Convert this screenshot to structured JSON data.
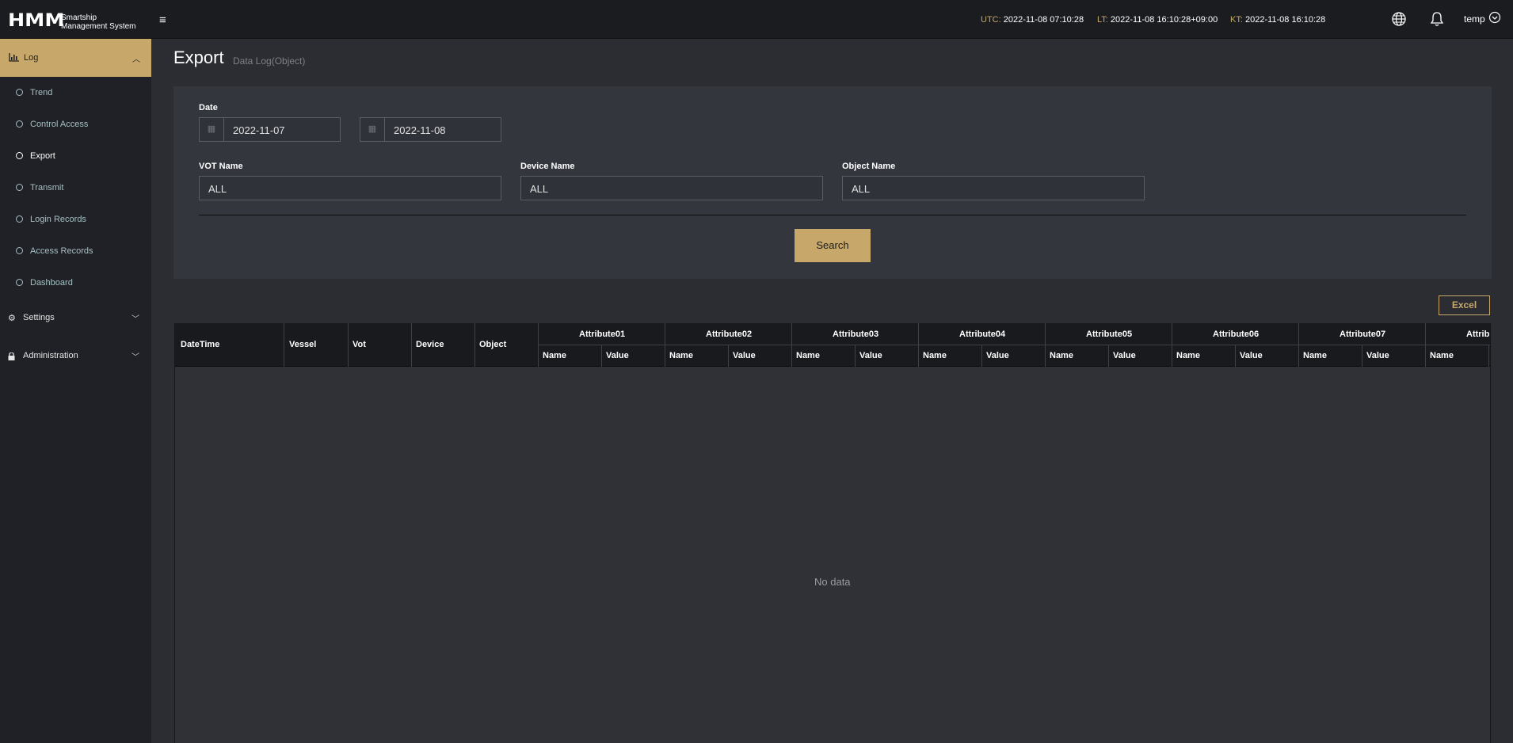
{
  "app": {
    "logo_text": "HMM",
    "brand_line1": "Smartship",
    "brand_line2": "Management System",
    "menu_icon": "≡"
  },
  "clocks": {
    "utc_label": "UTC:",
    "utc_value": "2022-11-08 07:10:28",
    "lt_label": "LT:",
    "lt_value": "2022-11-08 16:10:28+09:00",
    "kt_label": "KT:",
    "kt_value": "2022-11-08 16:10:28"
  },
  "user": {
    "name": "temp"
  },
  "sidebar": {
    "log_label": "Log",
    "items": [
      {
        "label": "Trend"
      },
      {
        "label": "Control Access"
      },
      {
        "label": "Export"
      },
      {
        "label": "Transmit"
      },
      {
        "label": "Login Records"
      },
      {
        "label": "Access Records"
      },
      {
        "label": "Dashboard"
      }
    ],
    "settings_label": "Settings",
    "admin_label": "Administration"
  },
  "page": {
    "title": "Export",
    "subtitle": "Data Log(Object)"
  },
  "filters": {
    "date_label": "Date",
    "date_from": "2022-11-07",
    "date_to": "2022-11-08",
    "vot_label": "VOT Name",
    "vot_value": "ALL",
    "device_label": "Device Name",
    "device_value": "ALL",
    "object_label": "Object Name",
    "object_value": "ALL",
    "search_label": "Search"
  },
  "excel_label": "Excel",
  "table": {
    "fixed_columns": [
      "DateTime",
      "Vessel",
      "Vot",
      "Device",
      "Object"
    ],
    "attribute_groups": [
      "Attribute01",
      "Attribute02",
      "Attribute03",
      "Attribute04",
      "Attribute05",
      "Attribute06",
      "Attribute07",
      "Attribu"
    ],
    "sub_name": "Name",
    "sub_value": "Value",
    "empty_text": "No data"
  },
  "colors": {
    "accent": "#c7a86a",
    "topbar": "#1a1c20",
    "sidebar": "#1f2126",
    "panel": "#33363d"
  }
}
